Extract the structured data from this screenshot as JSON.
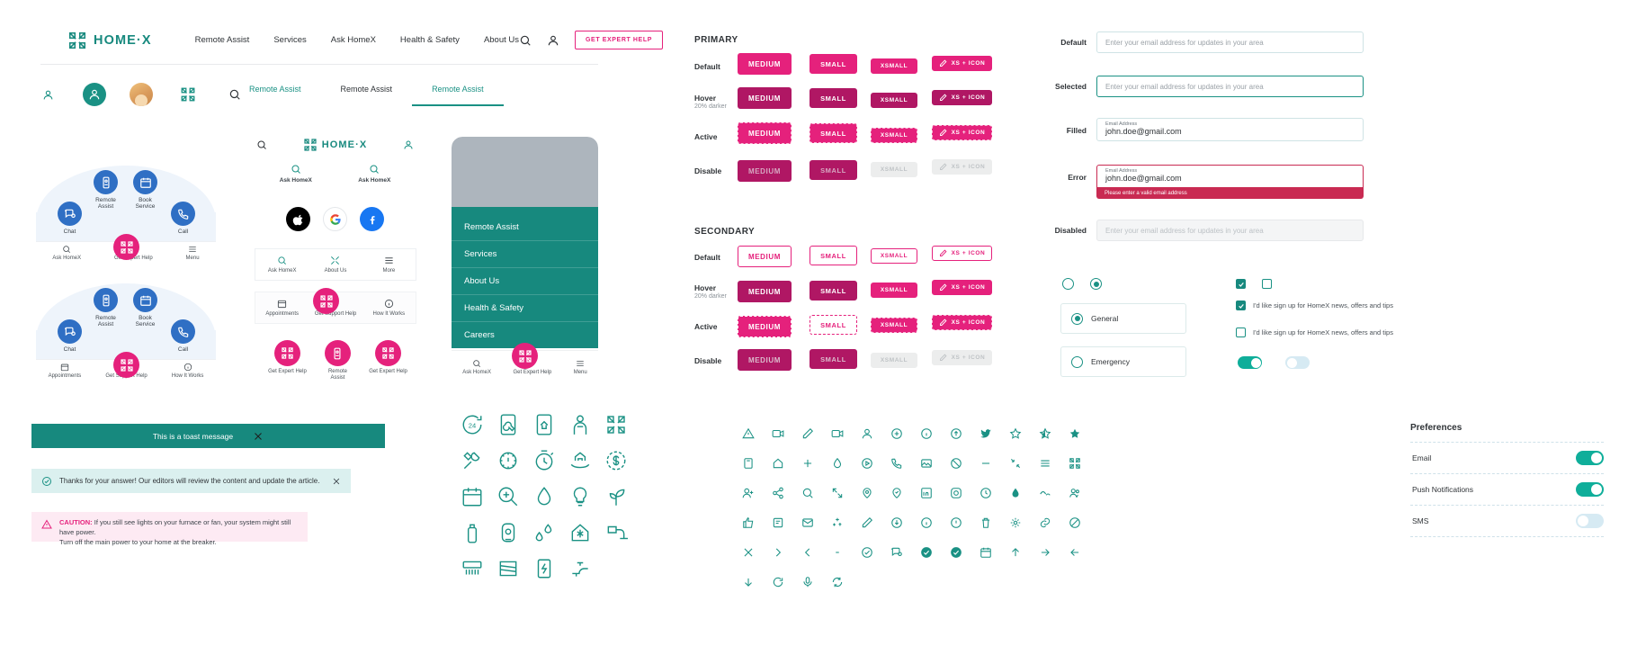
{
  "header": {
    "brand": "HOME·X",
    "nav": [
      {
        "label": "Remote Assist"
      },
      {
        "label": "Services"
      },
      {
        "label": "Ask HomeX"
      },
      {
        "label": "Health & Safety"
      },
      {
        "label": "About Us"
      }
    ],
    "cta": "GET EXPERT HELP"
  },
  "tabs": [
    {
      "label": "Remote Assist",
      "state": "active-teal"
    },
    {
      "label": "Remote Assist",
      "state": "plain"
    },
    {
      "label": "Remote Assist",
      "state": "underlined"
    }
  ],
  "arc_widget": {
    "buttons": [
      {
        "label": "Chat",
        "icon": "chat-icon"
      },
      {
        "label": "Remote\nAssist",
        "icon": "remote-assist-icon"
      },
      {
        "label": "Book\nService",
        "icon": "calendar-icon"
      },
      {
        "label": "Call",
        "icon": "phone-icon"
      }
    ],
    "footer_a": [
      {
        "label": "Ask HomeX",
        "icon": "search-icon"
      },
      {
        "label": "Get Expert Help",
        "icon": "homex-mark-icon"
      },
      {
        "label": "Menu",
        "icon": "hamburger-icon"
      }
    ],
    "footer_b": [
      {
        "label": "Appointments",
        "icon": "calendar-icon"
      },
      {
        "label": "Get Support Help",
        "icon": "homex-mark-icon"
      },
      {
        "label": "How It Works",
        "icon": "info-icon"
      }
    ]
  },
  "mobile_card": {
    "brand": "HOME·X",
    "quad": [
      {
        "label": "Ask HomeX",
        "icon": "search-icon"
      },
      {
        "label": "Ask HomeX",
        "icon": "search-icon"
      }
    ],
    "social": [
      {
        "name": "apple-icon"
      },
      {
        "name": "google-icon"
      },
      {
        "name": "facebook-icon"
      }
    ],
    "tri": [
      {
        "label": "Ask HomeX",
        "icon": "search-icon"
      },
      {
        "label": "About Us",
        "icon": "homex-mark-icon"
      },
      {
        "label": "More",
        "icon": "hamburger-icon"
      }
    ],
    "bar": [
      {
        "label": "Appointments",
        "icon": "calendar-icon"
      },
      {
        "label": "Get Support Help",
        "icon": "homex-mark-icon"
      },
      {
        "label": "How It Works",
        "icon": "info-icon"
      }
    ],
    "pink_row": [
      {
        "label": "Get Expert Help",
        "icon": "homex-mark-icon"
      },
      {
        "label": "Remote\nAssist",
        "icon": "remote-assist-icon"
      },
      {
        "label": "Get Expert Help",
        "icon": "homex-mark-icon"
      }
    ]
  },
  "phone_drawer": {
    "menu": [
      {
        "label": "Remote Assist"
      },
      {
        "label": "Services"
      },
      {
        "label": "About Us"
      },
      {
        "label": "Health & Safety"
      },
      {
        "label": "Careers"
      }
    ],
    "footer": [
      {
        "label": "Ask HomeX",
        "icon": "search-icon"
      },
      {
        "label": "Get Expert Help",
        "icon": "homex-mark-icon"
      },
      {
        "label": "Menu",
        "icon": "hamburger-icon"
      }
    ]
  },
  "toast": {
    "message": "This is a toast message",
    "close": "✕"
  },
  "alert_info": {
    "message": "Thanks for your answer! Our editors will review the content and update the article.",
    "close": "✕"
  },
  "alert_caution": {
    "prefix": "CAUTION:",
    "line1": " If you still see lights on your furnace or fan, your system might still have power.",
    "line2": "Turn off the main power to your home at the breaker."
  },
  "buttons": {
    "primary_title": "PRIMARY",
    "secondary_title": "SECONDARY",
    "rows": [
      {
        "label": "Default",
        "sub": ""
      },
      {
        "label": "Hover",
        "sub": "20% darker"
      },
      {
        "label": "Active",
        "sub": ""
      },
      {
        "label": "Disable",
        "sub": ""
      }
    ],
    "sizes": {
      "medium": "MEDIUM",
      "small": "SMALL",
      "xsmall": "XSMALL",
      "xs_icon": "XS + ICON"
    }
  },
  "fields": [
    {
      "label": "Default",
      "state": "default",
      "placeholder": "Enter your email address for updates in your area",
      "value": "",
      "minilabel": ""
    },
    {
      "label": "Selected",
      "state": "selected",
      "placeholder": "Enter your email address for updates in your area",
      "value": "",
      "minilabel": ""
    },
    {
      "label": "Filled",
      "state": "filled",
      "placeholder": "",
      "value": "john.doe@gmail.com",
      "minilabel": "Email Address"
    },
    {
      "label": "Error",
      "state": "error",
      "placeholder": "",
      "value": "john.doe@gmail.com",
      "minilabel": "Email Address",
      "error": "Please enter a valid email address"
    },
    {
      "label": "Disabled",
      "state": "disabled",
      "placeholder": "Enter your email address for updates in your area",
      "value": "",
      "minilabel": ""
    }
  ],
  "radio_cards": [
    {
      "label": "General",
      "checked": true
    },
    {
      "label": "Emergency",
      "checked": false
    }
  ],
  "checkboxes": [
    {
      "label": "I'd like sign up for HomeX news, offers and tips",
      "checked": true
    },
    {
      "label": "I'd like sign up for HomeX news, offers and tips",
      "checked": false
    }
  ],
  "toggles": [
    {
      "state": "on"
    },
    {
      "state": "off"
    }
  ],
  "preferences": {
    "title": "Preferences",
    "rows": [
      {
        "label": "Email",
        "state": "on"
      },
      {
        "label": "Push Notifications",
        "state": "on"
      },
      {
        "label": "SMS",
        "state": "off"
      }
    ]
  },
  "icon_grid_large": [
    "24-hour-icon",
    "mobile-wrench-icon",
    "mobile-home-icon",
    "technician-icon",
    "homex-mark-icon",
    "plumbing-tools-icon",
    "gear-thermometer-icon",
    "stopwatch-icon",
    "hand-home-icon",
    "dollar-clock-icon",
    "calendar-grid-icon",
    "search-tools-icon",
    "water-drop-icon",
    "lightbulb-icon",
    "leaf-plug-icon",
    "spray-can-icon",
    "water-heater-icon",
    "steam-drops-icon",
    "snowflake-home-icon",
    "duct-icon",
    "vent-icon",
    "filter-icon",
    "circuit-icon",
    "faucet-icon"
  ],
  "icon_grid_small": [
    "alert-triangle-icon",
    "video-icon",
    "pencil-icon",
    "video-camera-icon",
    "user-icon",
    "plus-circle-icon",
    "info-circle-icon",
    "up-circle-icon",
    "twitter-icon",
    "star-outline-icon",
    "star-half-icon",
    "star-filled-icon",
    "homex-mark-icon",
    "add-user-icon",
    "share-icon",
    "search-icon",
    "book-icon",
    "home-icon",
    "plus-icon",
    "drop-icon",
    "play-circle-icon",
    "phone-icon",
    "image-icon",
    "block-icon",
    "minus-icon",
    "shrink-icon",
    "list-icon",
    "homex-mark-icon",
    "expand-icon",
    "pin-icon",
    "pin-check-icon",
    "linkedin-icon",
    "instagram-icon",
    "clock-icon",
    "droplet-icon",
    "wave-icon",
    "users-icon",
    "thumbs-up-icon",
    "calendar-note-icon",
    "mail-icon",
    "sparkle-icon",
    "pencil-icon",
    "download-icon",
    "info-icon",
    "alert-circle-icon",
    "trash-icon",
    "gear-icon",
    "link-icon",
    "close-icon",
    "chevron-right-icon",
    "chevron-left-icon",
    "dash-icon",
    "check-circle-outline-icon",
    "chat-icon",
    "check-circle-icon",
    "check-circle-alt-icon",
    "calendar-icon",
    "arrow-up-icon",
    "arrow-right-icon",
    "arrow-left-icon",
    "arrow-down-icon",
    "refresh-icon",
    "mic-icon",
    "sync-icon"
  ],
  "colors": {
    "pink": "#e5217c",
    "pink_dark": "#b01764",
    "teal": "#1a9184",
    "teal_dark": "#17897e",
    "blue": "#2f6fc4",
    "error": "#c92a52"
  }
}
